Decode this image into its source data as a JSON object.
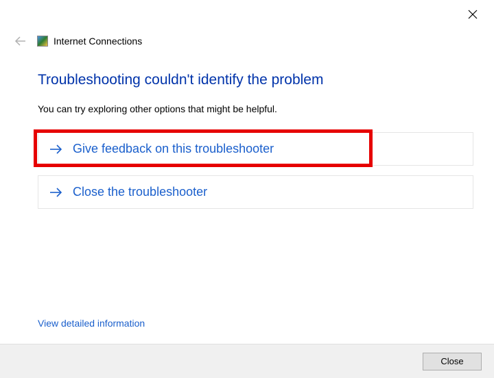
{
  "window": {
    "title": "Internet Connections"
  },
  "main": {
    "heading": "Troubleshooting couldn't identify the problem",
    "subtext": "You can try exploring other options that might be helpful.",
    "options": [
      {
        "label": "Give feedback on this troubleshooter"
      },
      {
        "label": "Close the troubleshooter"
      }
    ],
    "detail_link": "View detailed information"
  },
  "footer": {
    "close": "Close"
  }
}
